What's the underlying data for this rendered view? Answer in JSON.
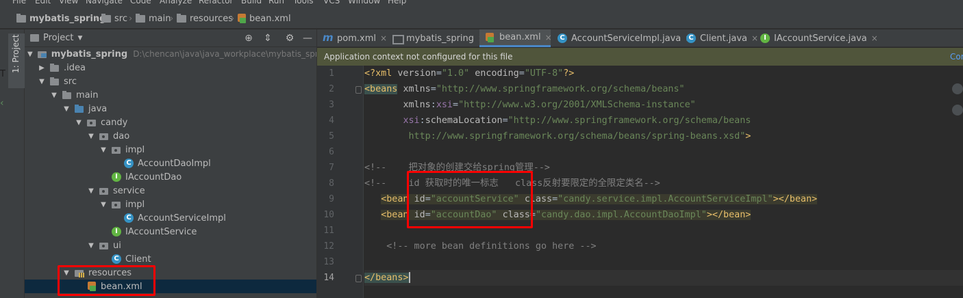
{
  "menu": [
    "File",
    "Edit",
    "View",
    "Navigate",
    "Code",
    "Analyze",
    "Refactor",
    "Build",
    "Run",
    "Tools",
    "VCS",
    "Window",
    "Help"
  ],
  "breadcrumb": {
    "items": [
      "mybatis_spring",
      "src",
      "main",
      "resources",
      "bean.xml"
    ],
    "separator": "›"
  },
  "toolstrip": {
    "project_tab": "1: Project",
    "left_T": "T",
    "left_mark": "‹"
  },
  "project_panel": {
    "title": "Project",
    "dropdown_arrow": "▼",
    "buttons": {
      "locate": "⊕",
      "collapse": "⇕",
      "settings": "⚙",
      "hide": "—"
    },
    "tree": [
      {
        "label": "mybatis_spring",
        "hint": "D:\\chencan\\java\\java_workplace\\mybatis_spring",
        "expander": "▼",
        "icon": "module-icon"
      },
      {
        "label": ".idea",
        "expander": "▶",
        "icon": "folder-icon"
      },
      {
        "label": "src",
        "expander": "▼",
        "icon": "folder-icon"
      },
      {
        "label": "main",
        "expander": "▼",
        "icon": "folder-icon"
      },
      {
        "label": "java",
        "expander": "▼",
        "icon": "source-folder-icon"
      },
      {
        "label": "candy",
        "expander": "▼",
        "icon": "package-icon"
      },
      {
        "label": "dao",
        "expander": "▼",
        "icon": "package-icon"
      },
      {
        "label": "impl",
        "expander": "▼",
        "icon": "package-icon"
      },
      {
        "label": "AccountDaoImpl",
        "expander": "",
        "icon": "class-icon"
      },
      {
        "label": "IAccountDao",
        "expander": "",
        "icon": "interface-icon"
      },
      {
        "label": "service",
        "expander": "▼",
        "icon": "package-icon"
      },
      {
        "label": "impl",
        "expander": "▼",
        "icon": "package-icon"
      },
      {
        "label": "AccountServiceImpl",
        "expander": "",
        "icon": "class-icon"
      },
      {
        "label": "IAccountService",
        "expander": "",
        "icon": "interface-icon"
      },
      {
        "label": "ui",
        "expander": "▼",
        "icon": "package-icon"
      },
      {
        "label": "Client",
        "expander": "",
        "icon": "class-icon"
      },
      {
        "label": "resources",
        "expander": "▼",
        "icon": "resources-folder-icon"
      },
      {
        "label": "bean.xml",
        "expander": "",
        "icon": "xml-file-icon"
      }
    ]
  },
  "editor": {
    "tabs": [
      {
        "label": "pom.xml",
        "icon": "maven-icon",
        "close": "×"
      },
      {
        "label": "mybatis_spring",
        "icon": "module-icon",
        "close": "×"
      },
      {
        "label": "bean.xml",
        "icon": "xml-file-icon",
        "close": "×",
        "active": true
      },
      {
        "label": "AccountServiceImpl.java",
        "icon": "class-icon",
        "close": "×"
      },
      {
        "label": "Client.java",
        "icon": "class-icon",
        "close": "×"
      },
      {
        "label": "IAccountService.java",
        "icon": "interface-icon",
        "close": "×"
      }
    ],
    "banner": {
      "message": "Application context not configured for this file",
      "action": "Cor"
    },
    "line_numbers": [
      "1",
      "2",
      "3",
      "4",
      "5",
      "6",
      "7",
      "8",
      "9",
      "10",
      "11",
      "12",
      "13",
      "14"
    ],
    "current_line": "14",
    "code": {
      "l1": {
        "open": "<?xml ",
        "a1": "version",
        "eq1": "=",
        "v1": "\"1.0\"",
        "sp": " ",
        "a2": "encoding",
        "eq2": "=",
        "v2": "\"UTF-8\"",
        "close": "?>"
      },
      "l2": {
        "tag": "<beans",
        "sp": " ",
        "attr": "xmlns",
        "eq": "=",
        "val": "\"http://www.springframework.org/schema/beans\""
      },
      "l3": {
        "indent": "       ",
        "attr": "xmlns",
        "colon": ":",
        "ns": "xsi",
        "eq": "=",
        "val": "\"http://www.w3.org/2001/XMLSchema-instance\""
      },
      "l4": {
        "indent": "       ",
        "ns": "xsi",
        "colon": ":",
        "attr": "schemaLocation",
        "eq": "=",
        "val": "\"http://www.springframework.org/schema/beans"
      },
      "l5": {
        "indent": "        ",
        "val": "http://www.springframework.org/schema/beans/spring-beans.xsd\"",
        "close": ">"
      },
      "l7": {
        "text": "<!--    把对象的创建交给spring管理-->"
      },
      "l8": {
        "text": "<!--    id 获取时的唯一标志   class反射要限定的全限定类名-->"
      },
      "l9": {
        "indent": "   ",
        "tag": "<bean",
        "sp1": " ",
        "a1": "id",
        "eq1": "=",
        "v1": "\"accountService\"",
        "sp2": " ",
        "a2": "class",
        "eq2": "=",
        "v2": "\"candy.service.impl.AccountServiceImpl\"",
        "close": "></bean>"
      },
      "l10": {
        "indent": "   ",
        "tag": "<bean",
        "sp1": " ",
        "a1": "id",
        "eq1": "=",
        "v1": "\"accountDao\"",
        "sp2": " ",
        "a2": "class",
        "eq2": "=",
        "v2": "\"candy.dao.impl.AccountDaoImpl\"",
        "close": "></bean>"
      },
      "l12": {
        "text": "    <!-- more bean definitions go here -->"
      },
      "l14": {
        "tag": "</beans>"
      }
    }
  },
  "colors": {
    "annotation_box": "#ff0000",
    "active_tab_underline": "#4a88c7",
    "banner_bg": "#50553b"
  }
}
